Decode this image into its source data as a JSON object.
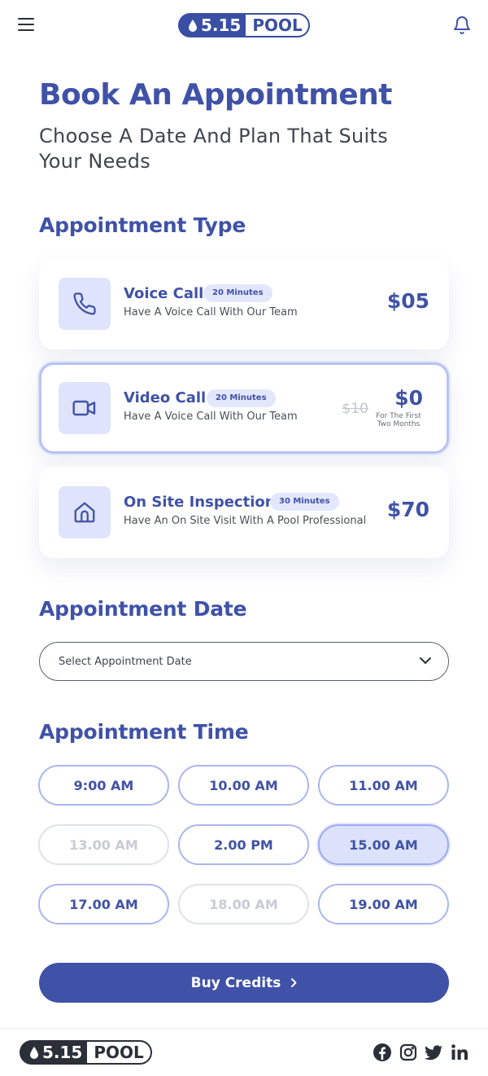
{
  "brand": {
    "logo_number": "5.15",
    "logo_word": "POOL"
  },
  "header": {
    "title": "Book An Appointment",
    "subtitle": "Choose A Date And Plan That Suits Your Needs"
  },
  "sections": {
    "type_title": "Appointment Type",
    "date_title": "Appointment Date",
    "time_title": "Appointment Time"
  },
  "appointment_types": [
    {
      "title": "Voice Call",
      "badge": "20 Minutes",
      "description": "Have A Voice Call With Our Team",
      "price": "$05",
      "icon": "phone-icon"
    },
    {
      "title": "Video Call",
      "badge": "20 Minutes",
      "description": "Have A Voice Call With Our Team",
      "old_price": "$10",
      "price": "$0",
      "note": "For The First Two Months",
      "icon": "video-icon",
      "selected": true
    },
    {
      "title": "On Site Inspection",
      "badge": "30 Minutes",
      "description": "Have An On Site Visit With A Pool Professional",
      "price": "$70",
      "icon": "home-icon"
    }
  ],
  "date_select": {
    "placeholder": "Select Appointment Date"
  },
  "time_slots": [
    {
      "label": "9:00 AM",
      "state": "available"
    },
    {
      "label": "10.00 AM",
      "state": "available"
    },
    {
      "label": "11.00 AM",
      "state": "available"
    },
    {
      "label": "13.00 AM",
      "state": "disabled"
    },
    {
      "label": "2.00 PM",
      "state": "available"
    },
    {
      "label": "15.00 AM",
      "state": "selected"
    },
    {
      "label": "17.00 AM",
      "state": "available"
    },
    {
      "label": "18.00 AM",
      "state": "disabled"
    },
    {
      "label": "19.00 AM",
      "state": "available"
    }
  ],
  "cta": {
    "label": "Buy Credits"
  },
  "footer": {
    "social": [
      "facebook-icon",
      "instagram-icon",
      "twitter-icon",
      "linkedin-icon"
    ]
  },
  "colors": {
    "primary": "#3f52a7",
    "accent_light": "#dfe3fb",
    "slot_border": "#aab6ee",
    "disabled": "#c8cbd3"
  }
}
